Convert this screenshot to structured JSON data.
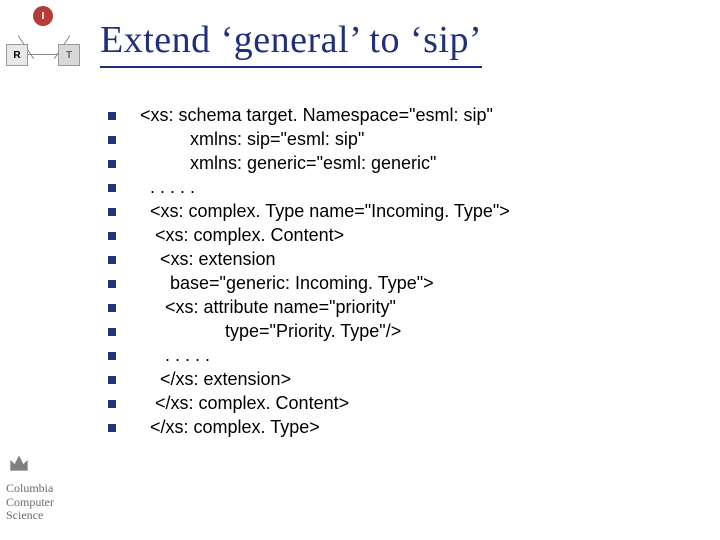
{
  "diagram": {
    "i": "I",
    "r": "R",
    "t": "T"
  },
  "title": "Extend ‘general’ to ‘sip’",
  "code_lines": [
    "<xs: schema target. Namespace=\"esml: sip\"",
    "          xmlns: sip=\"esml: sip\"",
    "          xmlns: generic=\"esml: generic\"",
    "  . . . . .",
    "  <xs: complex. Type name=\"Incoming. Type\">",
    "   <xs: complex. Content>",
    "    <xs: extension",
    "      base=\"generic: Incoming. Type\">",
    "     <xs: attribute name=\"priority\"",
    "                 type=\"Priority. Type\"/>",
    "     . . . . .",
    "    </xs: extension>",
    "   </xs: complex. Content>",
    "  </xs: complex. Type>"
  ],
  "logo": {
    "line1": "Columbia",
    "line2": "Computer",
    "line3": "Science"
  }
}
